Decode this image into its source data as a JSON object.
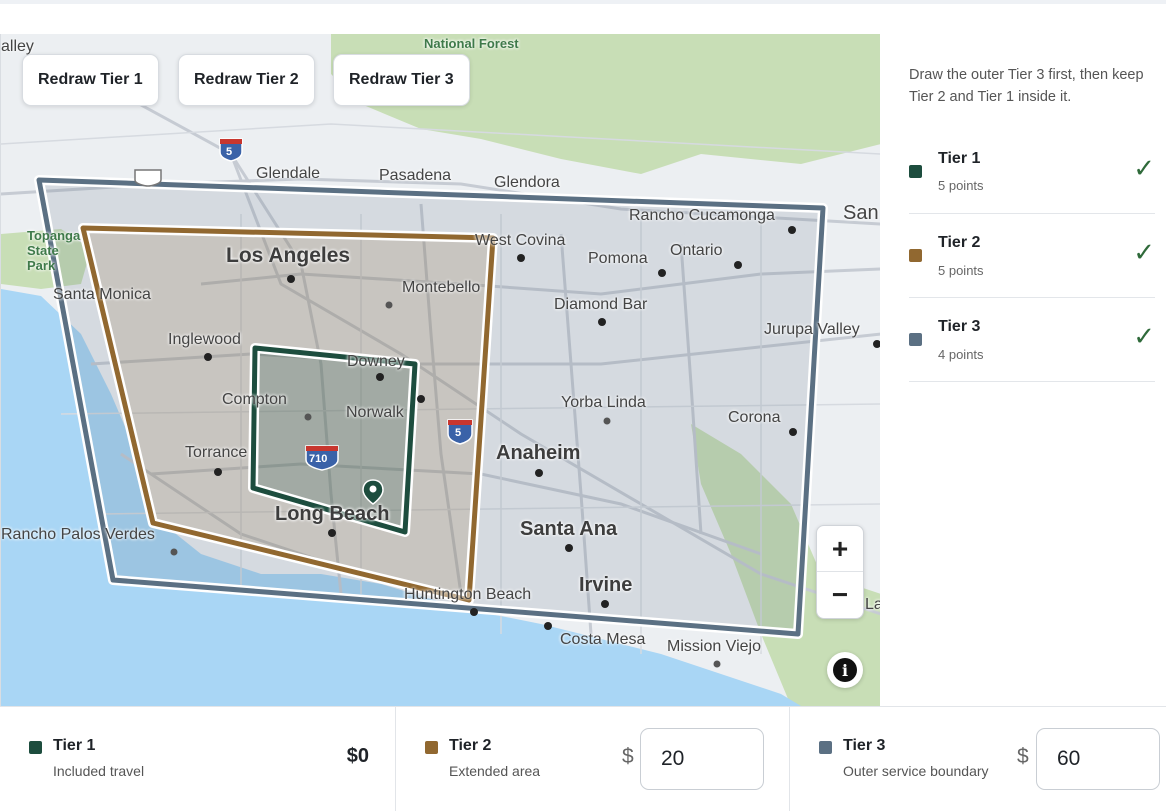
{
  "colors": {
    "tier1": "#1d4d3e",
    "tier2": "#916830",
    "tier3": "#5b7083",
    "check": "#2f6a3a",
    "water": "#a9d6f5",
    "parkland": "#c8deb6"
  },
  "map": {
    "redraw_buttons": [
      "Redraw Tier 1",
      "Redraw Tier 2",
      "Redraw Tier 3"
    ],
    "places": {
      "valley": "alley",
      "national_forest": "National Forest",
      "glendale": "Glendale",
      "pasadena": "Pasadena",
      "glendora": "Glendora",
      "san": "San",
      "rancho_cucamonga": "Rancho Cucamonga",
      "west_covina": "West Covina",
      "pomona": "Pomona",
      "ontario": "Ontario",
      "topanga": "Topanga State Park",
      "los_angeles": "Los Angeles",
      "montebello": "Montebello",
      "santa_monica": "Santa Monica",
      "diamond_bar": "Diamond Bar",
      "jurupa_valley": "Jurupa Valley",
      "inglewood": "Inglewood",
      "downey": "Downey",
      "compton": "Compton",
      "norwalk": "Norwalk",
      "yorba_linda": "Yorba Linda",
      "corona": "Corona",
      "torrance": "Torrance",
      "anaheim": "Anaheim",
      "long_beach": "Long Beach",
      "santa_ana": "Santa Ana",
      "rancho_palos_verdes": "Rancho Palos Verdes",
      "irvine": "Irvine",
      "huntington_beach": "Huntington Beach",
      "costa_mesa": "Costa Mesa",
      "mission_viejo": "Mission Viejo",
      "lake": "La"
    },
    "shields": {
      "i5_north": "5",
      "i5_south": "5",
      "i710": "710"
    },
    "zoom_in": "+",
    "zoom_out": "−",
    "info": "i"
  },
  "side": {
    "instructions": "Draw the outer Tier 3 first, then keep Tier 2 and Tier 1 inside it.",
    "tiers": [
      {
        "name": "Tier 1",
        "points": "5 points",
        "check": "✓"
      },
      {
        "name": "Tier 2",
        "points": "5 points",
        "check": "✓"
      },
      {
        "name": "Tier 3",
        "points": "4 points",
        "check": "✓"
      }
    ]
  },
  "pricing": {
    "currency": "$",
    "tier1": {
      "name": "Tier 1",
      "desc": "Included travel",
      "price": "$0"
    },
    "tier2": {
      "name": "Tier 2",
      "desc": "Extended area",
      "value": "20"
    },
    "tier3": {
      "name": "Tier 3",
      "desc": "Outer service boundary",
      "value": "60"
    }
  }
}
